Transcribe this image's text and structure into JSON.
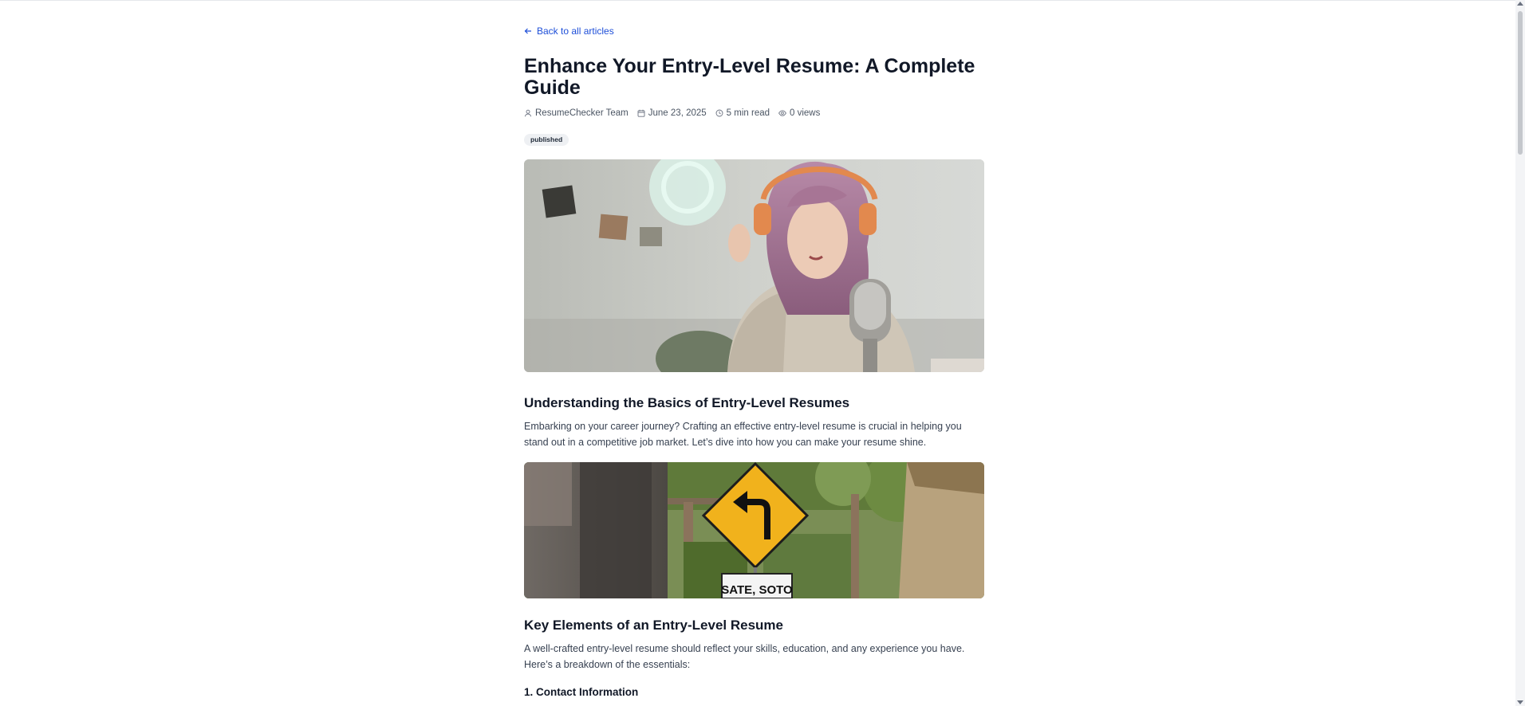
{
  "nav": {
    "back_label": "Back to all articles"
  },
  "article": {
    "title": "Enhance Your Entry-Level Resume: A Complete Guide",
    "meta": {
      "author": "ResumeChecker Team",
      "date": "June 23, 2025",
      "read_time": "5 min read",
      "views": "0 views"
    },
    "status_badge": "published",
    "sections": [
      {
        "heading": "Understanding the Basics of Entry-Level Resumes",
        "paragraph": "Embarking on your career journey? Crafting an effective entry-level resume is crucial in helping you stand out in a competitive job market. Let’s dive into how you can make your resume shine."
      },
      {
        "heading": "Key Elements of an Entry-Level Resume",
        "paragraph": "A well-crafted entry-level resume should reflect your skills, education, and any experience you have. Here’s a breakdown of the essentials:"
      }
    ],
    "subheading": "1. Contact Information",
    "road_sign_text": "SATE, SOTO"
  },
  "colors": {
    "link": "#1d4ed8",
    "text": "#111827",
    "muted": "#4b5563",
    "badge_bg": "#eef0f3"
  }
}
